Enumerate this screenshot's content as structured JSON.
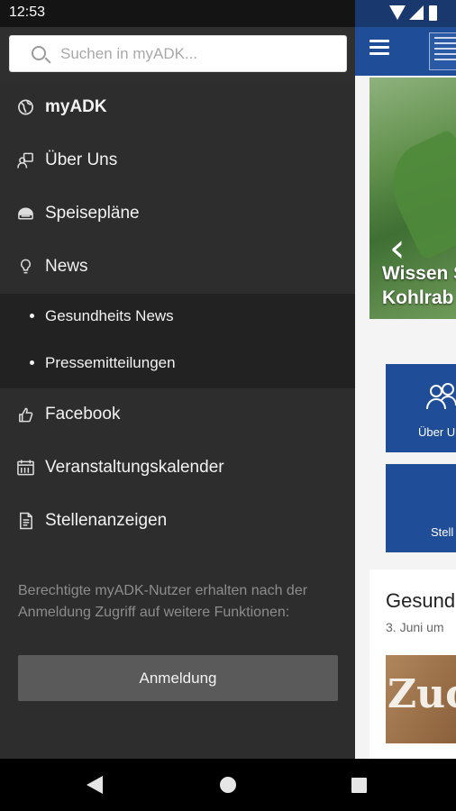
{
  "status_bar": {
    "time": "12:53"
  },
  "search": {
    "placeholder": "Suchen in myADK..."
  },
  "drawer": {
    "menu_items": [
      {
        "label": "myADK",
        "icon": "globe-icon"
      },
      {
        "label": "Über Uns",
        "icon": "people-icon"
      },
      {
        "label": "Speisepläne",
        "icon": "food-icon"
      },
      {
        "label": "News",
        "icon": "lightbulb-icon"
      }
    ],
    "news_subitems": [
      {
        "label": "Gesundheits News"
      },
      {
        "label": "Pressemitteilungen"
      }
    ],
    "menu_items_bottom": [
      {
        "label": "Facebook",
        "icon": "thumbs-up-icon"
      },
      {
        "label": "Veranstaltungskalender",
        "icon": "calendar-icon"
      },
      {
        "label": "Stellenanzeigen",
        "icon": "document-icon"
      }
    ],
    "info_text": "Berechtigte myADK-Nutzer erhalten nach der Anmeldung Zugriff auf weitere Funktionen:",
    "login_label": "Anmeldung"
  },
  "background_app": {
    "hero_title_line1": "Wissen S",
    "hero_title_line2": "Kohlrab",
    "tile1_label": "Über U",
    "tile2_label": "Stell",
    "card_title": "Gesund",
    "card_date": "3. Juni um",
    "card_image_text": "Zuc"
  },
  "colors": {
    "drawer_bg": "#2d2d2d",
    "submenu_bg": "#222222",
    "brand_blue": "#1f4d97",
    "login_button": "#5a5a5a"
  }
}
